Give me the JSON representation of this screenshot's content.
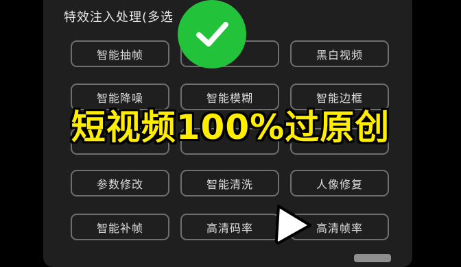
{
  "section": {
    "title": "特效注入处理(多选"
  },
  "options": [
    [
      "智能抽帧",
      "",
      "黑白视频"
    ],
    [
      "智能降噪",
      "智能模糊",
      "智能边框"
    ],
    [
      "",
      "",
      ""
    ],
    [
      "参数修改",
      "智能清洗",
      "人像修复"
    ],
    [
      "智能补帧",
      "高清码率",
      "高清帧率"
    ]
  ],
  "overlay": {
    "headline": "短视频100%过原创",
    "badge_icon": "check-icon",
    "badge_color": "#22c33b",
    "headline_color": "#ffee00",
    "cursor_icon": "play-cursor-icon"
  }
}
